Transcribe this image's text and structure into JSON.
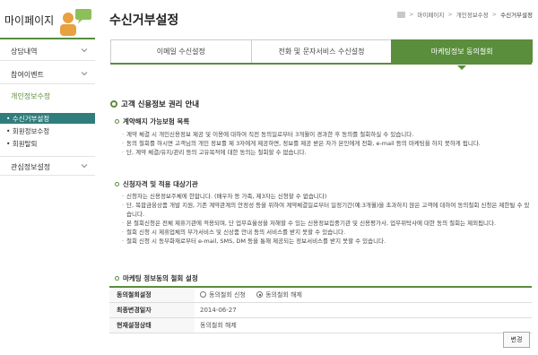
{
  "sidebar": {
    "title": "마이페이지",
    "items": [
      {
        "label": "상담내역"
      },
      {
        "label": "참여이벤트"
      },
      {
        "label": "개인정보수정"
      },
      {
        "label": "관심정보설정"
      }
    ],
    "subitems": [
      {
        "label": "• 수신거부설정"
      },
      {
        "label": "• 회원정보수정"
      },
      {
        "label": "• 회원탈퇴"
      }
    ]
  },
  "header": {
    "title": "수신거부설정",
    "breadcrumb": [
      "마이페이지",
      "개인정보수정",
      "수신거부설정"
    ]
  },
  "tabs": [
    {
      "label": "이메일 수신설정"
    },
    {
      "label": "전화 및 문자서비스 수신설정"
    },
    {
      "label": "마케팅정보 동의철회"
    }
  ],
  "section": {
    "title": "고객 신용정보 권리 안내",
    "block1": {
      "heading": "계약해지 가능보험 목록",
      "items": [
        "계약 체결 시 개인신용정보 제공 및 이용에 대하여 직전 동의일로부터 3개월이 경과한 후 동의를 철회하실 수 있습니다.",
        "동의 철회를 하시면 고객님의 개인 정보를 제 3자에게 제공하면, 정보를 제공 받은 자가 본인에게 전화, e-mail 등의 마케팅을 하지 못하게 됩니다.",
        "단, 계약 체결/유지/관리 등의 고유목적에 대한 동의는 철회할 수 없습니다."
      ]
    },
    "block2": {
      "heading": "신청자격 및 적용 대상기관",
      "items": [
        "신청자는 신용정보주체에 한합니다. (배우자 등 가족, 제3자는 신청할 수 없습니다)",
        "단, 복합금융상품 개발 지원, 기존 계약관계의 안정성 등을 위하여 계약체결일로부터 일정기간(예:3개월)을 초과하지 않은 고객에 대하여 동의철회 신청은 제한될 수 있습니다.",
        "본 철회신청은 전체 제휴기관에 적용되며, 단 업무효율성을 저해할 수 있는 신용정보집중기관 및 신용평가사, 업무위탁사에 대한 동의 철회는 제외됩니다.",
        "철회 신청 시 제휴업체의 부가서비스 및 신상품 안내 등의 서비스를 받지 못할 수 있습니다.",
        "철회 신청 시 동부화재로부터 e-mail, SMS, DM 등을 통해 제공되는 정보서비스를 받지 못할 수 있습니다."
      ]
    },
    "block3": {
      "heading": "마케팅 정보동의 철회 설정"
    }
  },
  "form": {
    "row1_label": "동의철회설정",
    "option1": "동의철회 신청",
    "option2": "동의철회 해제",
    "row2_label": "최종변경일자",
    "row2_value": "2014-06-27",
    "row3_label": "현재설정상태",
    "row3_value": "동의철회 해제"
  },
  "button_change": "변경",
  "colors": {
    "accent": "#5a8d3c",
    "selected_sub": "#2f7d7c"
  }
}
